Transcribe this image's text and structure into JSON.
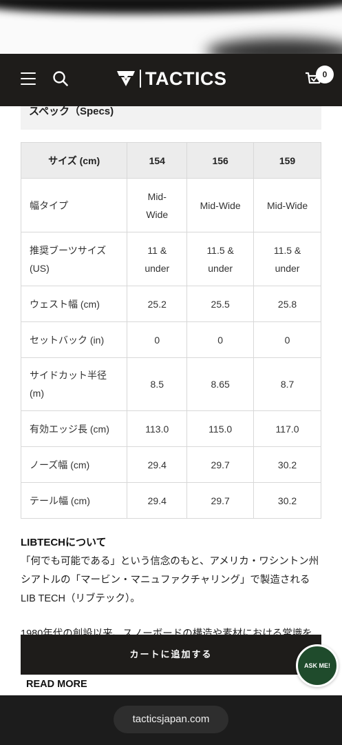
{
  "header": {
    "brand": "TACTICS",
    "cart_count": "0",
    "icons": [
      "hamburger-menu-icon",
      "search-icon",
      "tactics-logo-icon",
      "cart-icon"
    ]
  },
  "specs": {
    "heading": "スペック（Specs)",
    "columns": [
      "サイズ (cm)",
      "154",
      "156",
      "159"
    ],
    "rows": [
      {
        "label": "幅タイプ",
        "values": [
          "Mid-Wide",
          "Mid-Wide",
          "Mid-Wide"
        ]
      },
      {
        "label": "推奨ブーツサイズ (US)",
        "values": [
          "11 & under",
          "11.5 & under",
          "11.5 & under"
        ]
      },
      {
        "label": "ウェスト幅 (cm)",
        "values": [
          "25.2",
          "25.5",
          "25.8"
        ]
      },
      {
        "label": "セットバック (in)",
        "values": [
          "0",
          "0",
          "0"
        ]
      },
      {
        "label": "サイドカット半径 (m)",
        "values": [
          "8.5",
          "8.65",
          "8.7"
        ]
      },
      {
        "label": "有効エッジ長 (cm)",
        "values": [
          "113.0",
          "115.0",
          "117.0"
        ]
      },
      {
        "label": "ノーズ幅 (cm)",
        "values": [
          "29.4",
          "29.7",
          "30.2"
        ]
      },
      {
        "label": "テール幅 (cm)",
        "values": [
          "29.4",
          "29.7",
          "30.2"
        ]
      }
    ]
  },
  "about": {
    "title": "LIBTECHについて",
    "paragraph1": "「何でも可能である」という信念のもと、アメリカ・ワシントン州シアトルの「マービン・マニュファクチャリング」で製造されるLIB TECH（リブテック）。",
    "paragraph2": "1980年代の創設以来、スノーボードの構造や素材における常識を",
    "read_more": "READ MORE"
  },
  "actions": {
    "add_to_cart": "カートに追加する",
    "ask_me": "ASK ME!"
  },
  "browser": {
    "url": "tacticsjapan.com"
  },
  "colors": {
    "header_bg": "#1e1c1a",
    "ask_me_bg": "#1f4b2c",
    "table_header_bg": "#ececec"
  }
}
